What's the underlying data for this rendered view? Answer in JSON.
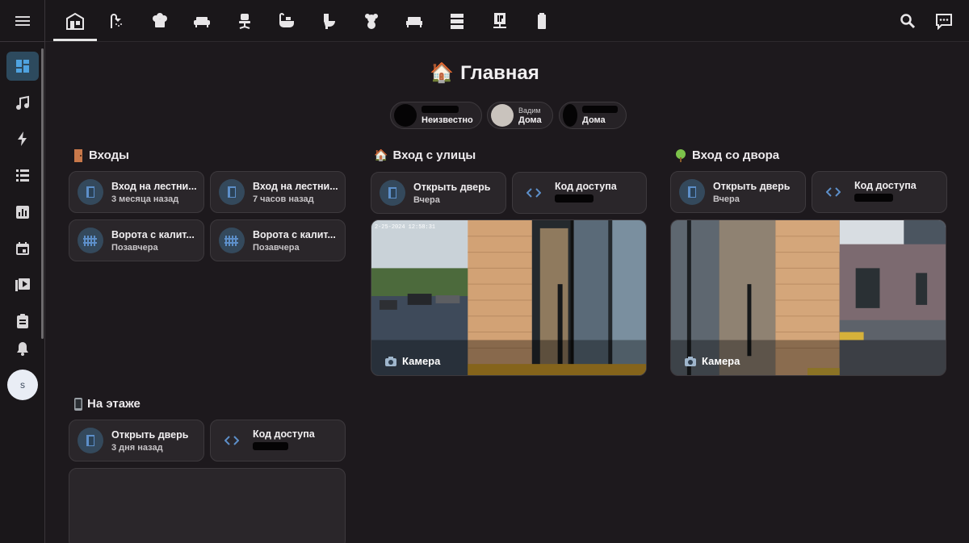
{
  "header": {
    "title": "Главная",
    "tabs": [
      {
        "icon": "home-floorplan-icon"
      },
      {
        "icon": "shower-icon"
      },
      {
        "icon": "chef-hat-icon"
      },
      {
        "icon": "sofa-icon"
      },
      {
        "icon": "office-chair-icon"
      },
      {
        "icon": "bathtub-icon"
      },
      {
        "icon": "toilet-icon"
      },
      {
        "icon": "teddy-bear-icon"
      },
      {
        "icon": "bed-icon"
      },
      {
        "icon": "server-icon"
      },
      {
        "icon": "ip-network-icon"
      },
      {
        "icon": "battery-icon"
      }
    ],
    "actions": [
      {
        "icon": "search-icon"
      },
      {
        "icon": "assist-chat-icon"
      }
    ]
  },
  "sidebar": {
    "items": [
      {
        "icon": "dashboard-icon",
        "active": true
      },
      {
        "icon": "music-icon"
      },
      {
        "icon": "lightning-icon"
      },
      {
        "icon": "list-icon"
      },
      {
        "icon": "chart-icon"
      },
      {
        "icon": "calendar-icon"
      },
      {
        "icon": "media-icon"
      },
      {
        "icon": "clipboard-icon"
      },
      {
        "icon": "bell-icon"
      }
    ],
    "user_initial": "s"
  },
  "persons": [
    {
      "name": "",
      "state": "Неизвестно"
    },
    {
      "name": "Вадим",
      "state": "Дома"
    },
    {
      "name": "",
      "state": "Дома"
    }
  ],
  "sections": {
    "entrances": {
      "title": "Входы",
      "tiles": [
        {
          "name": "Вход на лестни...",
          "state": "3 месяца назад",
          "icon": "door-icon"
        },
        {
          "name": "Вход на лестни...",
          "state": "7 часов назад",
          "icon": "door-icon"
        },
        {
          "name": "Ворота с калит...",
          "state": "Позавчера",
          "icon": "gate-icon"
        },
        {
          "name": "Ворота с калит...",
          "state": "Позавчера",
          "icon": "gate-icon"
        }
      ]
    },
    "street": {
      "title": "Вход с улицы",
      "open_door": {
        "name": "Открыть дверь",
        "state": "Вчера"
      },
      "access_code": {
        "name": "Код доступа"
      },
      "camera_label": "Камера",
      "camera_timestamp": "2-25-2024 12:58:31"
    },
    "yard": {
      "title": "Вход со двора",
      "open_door": {
        "name": "Открыть дверь",
        "state": "Вчера"
      },
      "access_code": {
        "name": "Код доступа"
      },
      "camera_label": "Камера"
    },
    "floor": {
      "title": "На этаже",
      "open_door": {
        "name": "Открыть дверь",
        "state": "3 дня назад"
      },
      "access_code": {
        "name": "Код доступа"
      }
    }
  },
  "colors": {
    "background": "#1d191d",
    "tile": "#2a262a",
    "icon_circle": "#34495c",
    "icon_blue": "#5d8fc9",
    "active_nav": "#2d4a5e"
  }
}
